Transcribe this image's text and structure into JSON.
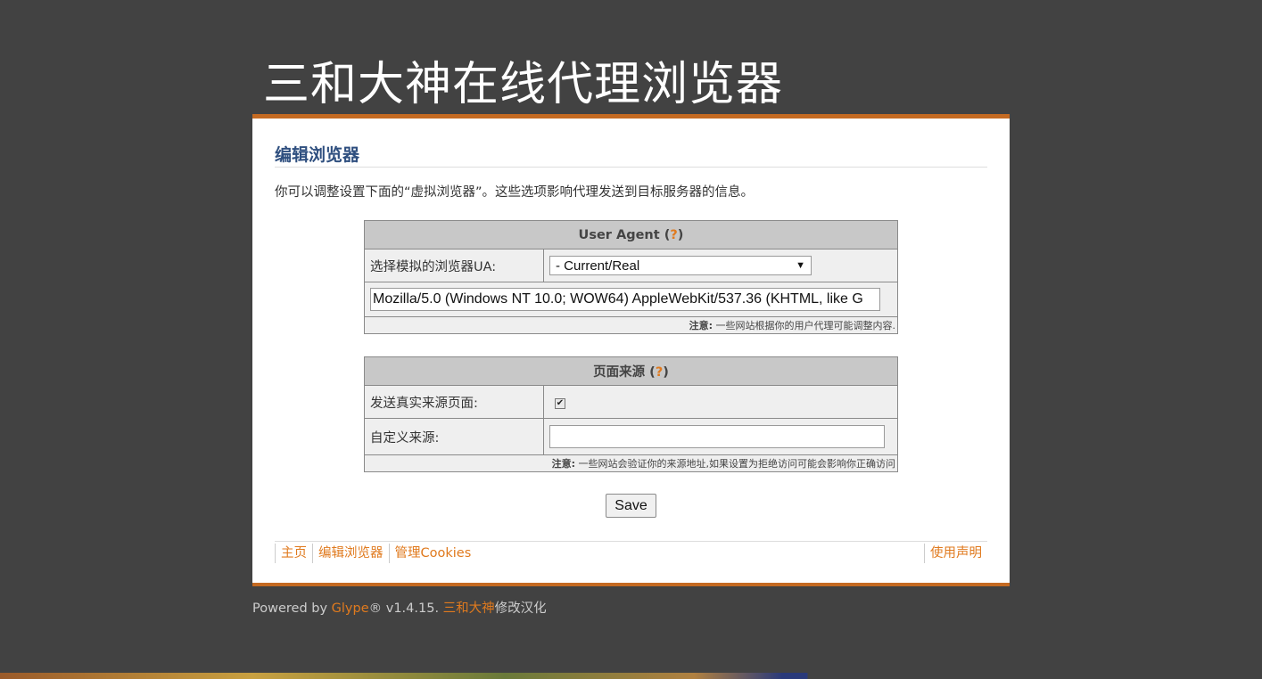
{
  "site": {
    "title": "三和大神在线代理浏览器"
  },
  "page": {
    "heading": "编辑浏览器",
    "intro": "你可以调整设置下面的“虚拟浏览器”。这些选项影响代理发送到目标服务器的信息。"
  },
  "user_agent": {
    "header": "User Agent",
    "help": "?",
    "select_label": "选择模拟的浏览器UA:",
    "select_value": "- Current/Real",
    "ua_string": "Mozilla/5.0 (Windows NT 10.0; WOW64) AppleWebKit/537.36 (KHTML, like G",
    "note_label": "注意:",
    "note_text": " 一些网站根据你的用户代理可能调整内容."
  },
  "referrer": {
    "header": "页面来源",
    "help": "?",
    "send_real_label": "发送真实来源页面:",
    "send_real_checked": true,
    "custom_label": "自定义来源:",
    "custom_value": "",
    "note_label": "注意:",
    "note_text": " 一些网站会验证你的来源地址,如果设置为拒绝访问可能会影响你正确访问"
  },
  "actions": {
    "save_label": "Save"
  },
  "footer_nav": {
    "items": [
      "主页",
      "编辑浏览器",
      "管理Cookies"
    ],
    "right": "使用声明"
  },
  "powered": {
    "prefix": "Powered by ",
    "brand": "Glype",
    "version": "® v1.4.15. ",
    "author": "三和大神",
    "suffix": "修改汉化"
  },
  "colors": {
    "background": "#424242",
    "accent": "#c46a22",
    "link": "#e07a1e",
    "heading": "#2f4f7f"
  }
}
